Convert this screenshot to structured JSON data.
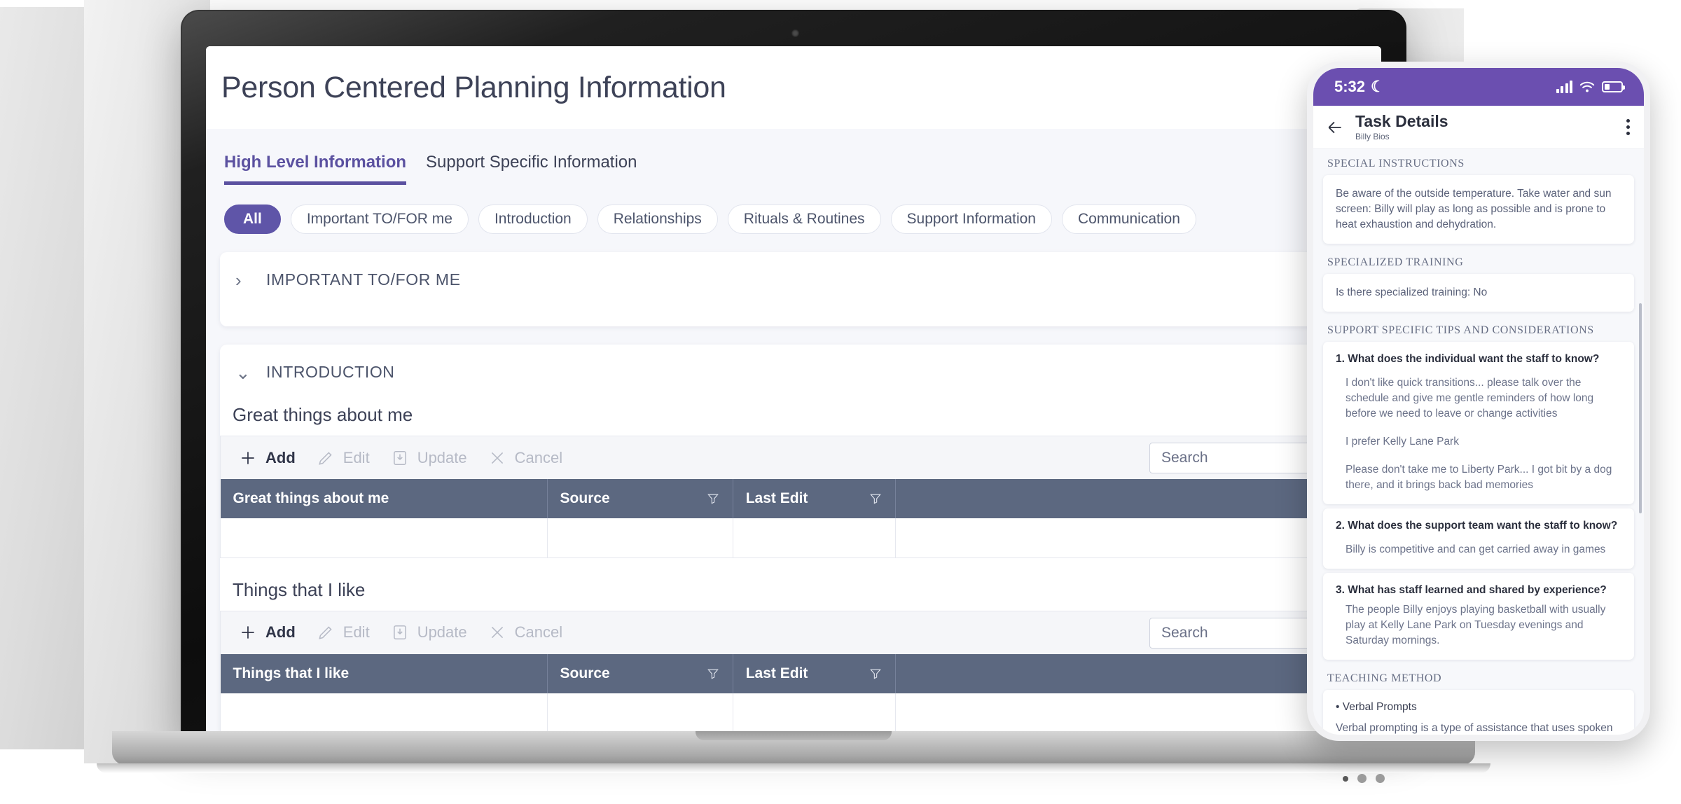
{
  "desktop": {
    "title": "Person Centered Planning Information",
    "tabs": [
      {
        "label": "High Level Information",
        "active": true
      },
      {
        "label": "Support Specific Information",
        "active": false
      }
    ],
    "chips": [
      {
        "label": "All",
        "active": true
      },
      {
        "label": "Important TO/FOR me",
        "active": false
      },
      {
        "label": "Introduction",
        "active": false
      },
      {
        "label": "Relationships",
        "active": false
      },
      {
        "label": "Rituals & Routines",
        "active": false
      },
      {
        "label": "Support Information",
        "active": false
      },
      {
        "label": "Communication",
        "active": false
      }
    ],
    "accordions": [
      {
        "title": "IMPORTANT TO/FOR ME",
        "expanded": false,
        "chevron": "›"
      },
      {
        "title": "INTRODUCTION",
        "expanded": true,
        "chevron": "⌄"
      }
    ],
    "toolbar": {
      "add_label": "Add",
      "edit_label": "Edit",
      "update_label": "Update",
      "cancel_label": "Cancel",
      "search_placeholder": "Search",
      "search_value": ""
    },
    "sections": [
      {
        "heading": "Great things about me",
        "columns": [
          "Great things about me",
          "Source",
          "Last Edit",
          ""
        ],
        "rows": []
      },
      {
        "heading": "Things that I like",
        "columns": [
          "Things that I like",
          "Source",
          "Last Edit",
          ""
        ],
        "rows": []
      }
    ],
    "colors": {
      "accent": "#5f55a8",
      "table_header": "#5c6880",
      "text": "#3d4257"
    }
  },
  "phone": {
    "status": {
      "time": "5:32",
      "moon": "☾"
    },
    "header": {
      "title": "Task Details",
      "subtitle": "Billy Bios"
    },
    "sections": [
      {
        "label": "SPECIAL INSTRUCTIONS",
        "body": "Be aware of the outside temperature. Take water and sun screen: Billy will play as long as possible and is prone to heat exhaustion and dehydration."
      },
      {
        "label": "SPECIALIZED TRAINING",
        "body": "Is there specialized training: No"
      }
    ],
    "tips": {
      "label": "SUPPORT SPECIFIC TIPS AND CONSIDERATIONS",
      "items": [
        {
          "question": "1. What does the individual want the staff to know?",
          "answers": [
            "I don't like quick transitions... please talk over the schedule and give me gentle reminders of how long before we need to leave or change activities",
            "I prefer Kelly Lane Park",
            "Please don't take me to Liberty Park... I got bit by a dog there, and it brings back bad memories"
          ]
        },
        {
          "question": "2. What does the support team want the staff to know?",
          "answers": [
            "Billy is competitive and can get carried away in games"
          ]
        },
        {
          "question": "3. What has staff learned and shared by experience?",
          "answers": [
            "The people Billy enjoys playing basketball with usually play at Kelly Lane Park on Tuesday evenings and Saturday mornings."
          ]
        }
      ]
    },
    "teaching": {
      "label": "TEACHING METHOD",
      "bullet": "• Verbal Prompts",
      "body": "Verbal prompting is a type of assistance that uses spoken words, signs, or statements to help people use target skills"
    },
    "colors": {
      "status_bar": "#6b4fb0"
    }
  }
}
